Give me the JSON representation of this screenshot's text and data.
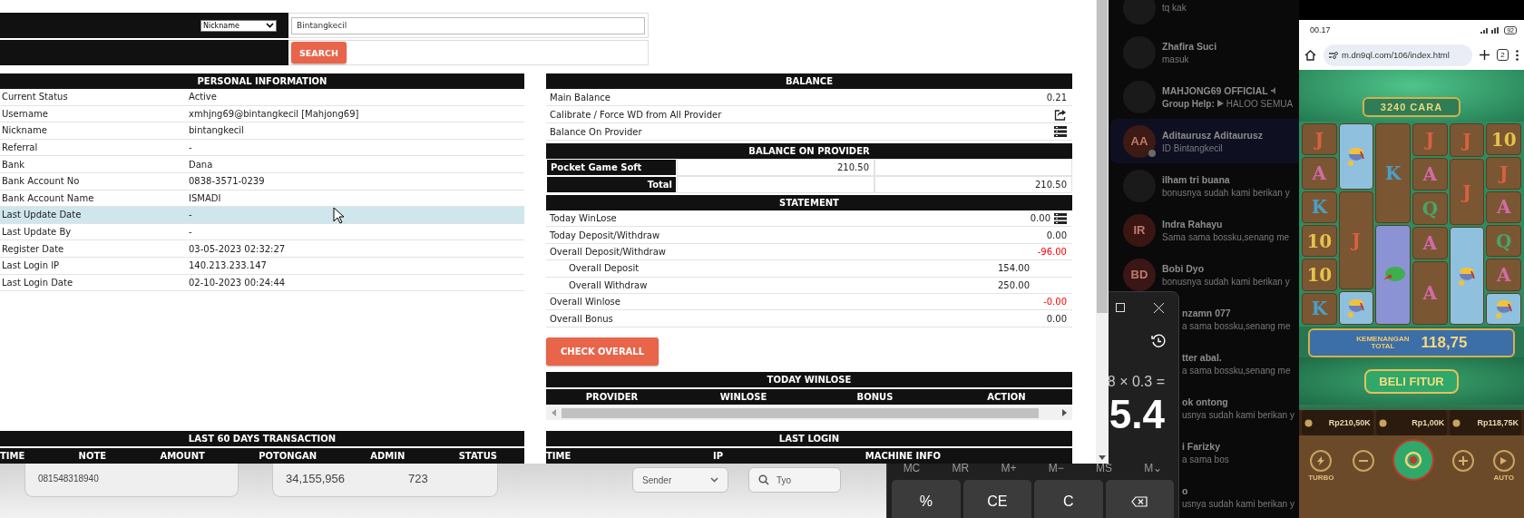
{
  "browser": {
    "search": {
      "field": "Nickname",
      "query": "Bintangkecil",
      "button": "SEARCH"
    },
    "personal_information": {
      "title": "PERSONAL INFORMATION",
      "rows": [
        {
          "label": "Current Status",
          "value": "Active",
          "highlighted": false
        },
        {
          "label": "Username",
          "value": "xmhjng69@bintangkecil  [Mahjong69]",
          "highlighted": false
        },
        {
          "label": "Nickname",
          "value": "bintangkecil",
          "highlighted": false
        },
        {
          "label": "Referral",
          "value": "-",
          "highlighted": false
        },
        {
          "label": "Bank",
          "value": "Dana",
          "highlighted": false
        },
        {
          "label": "Bank Account No",
          "value": "0838-3571-0239",
          "highlighted": false
        },
        {
          "label": "Bank Account Name",
          "value": "ISMADI",
          "highlighted": false
        },
        {
          "label": "Last Update Date",
          "value": "-",
          "highlighted": true
        },
        {
          "label": "Last Update By",
          "value": "-",
          "highlighted": false
        },
        {
          "label": "Register Date",
          "value": "03-05-2023 02:32:27",
          "highlighted": false
        },
        {
          "label": "Last Login IP",
          "value": "140.213.233.147",
          "highlighted": false
        },
        {
          "label": "Last Login Date",
          "value": "02-10-2023 00:24:44",
          "highlighted": false
        }
      ]
    },
    "last_60_days": {
      "title": "LAST 60 DAYS TRANSACTION",
      "columns": [
        "TIME",
        "NOTE",
        "AMOUNT",
        "POTONGAN",
        "ADMIN",
        "STATUS"
      ]
    },
    "balance": {
      "title": "BALANCE",
      "rows": [
        {
          "kind": "value",
          "label": "Main Balance",
          "value": "0.21"
        },
        {
          "kind": "share",
          "label": "Calibrate / Force WD from All Provider"
        },
        {
          "kind": "list",
          "label": "Balance On Provider"
        }
      ]
    },
    "balance_on_provider": {
      "title": "BALANCE ON PROVIDER",
      "rows": [
        {
          "name": "Pocket Game Soft",
          "amount": "210.50"
        }
      ],
      "total": {
        "label": "Total",
        "amount": "210.50"
      }
    },
    "statement": {
      "title": "STATEMENT",
      "rows": [
        {
          "kind": "with-list",
          "label": "Today WinLose",
          "value": "0.00",
          "color": "#222222"
        },
        {
          "kind": "plain",
          "label": "Today Deposit/Withdraw",
          "value": "0.00",
          "color": "#222222"
        },
        {
          "kind": "plain",
          "label": "Overall Deposit/Withdraw",
          "value": "-96.00",
          "color": "#ff0000"
        },
        {
          "kind": "sub",
          "label": "Overall Deposit",
          "value": "154.00",
          "color": "#222222"
        },
        {
          "kind": "sub",
          "label": "Overall Withdraw",
          "value": "250.00",
          "color": "#222222"
        },
        {
          "kind": "plain",
          "label": "Overall Winlose",
          "value": "-0.00",
          "color": "#ff0000"
        },
        {
          "kind": "plain",
          "label": "Overall Bonus",
          "value": "0.00",
          "color": "#222222"
        }
      ]
    },
    "check_button": "CHECK OVERALL",
    "today_winlose": {
      "title": "TODAY WINLOSE",
      "columns": [
        "PROVIDER",
        "WINLOSE",
        "BONUS",
        "ACTION"
      ]
    },
    "last_login": {
      "title": "LAST LOGIN",
      "columns": [
        "TIME",
        "IP",
        "MACHINE INFO"
      ]
    }
  },
  "background_app": {
    "phone_field": "081548318940",
    "amount": "34,155,956",
    "count": "723",
    "sender_select": "Sender",
    "search_value": "Tyo"
  },
  "chat_list": {
    "chats": [
      {
        "kind": "photo",
        "message": "tq kak",
        "selected": false
      },
      {
        "kind": "photo",
        "name": "Zhafira Suci",
        "message": "masuk",
        "selected": false
      },
      {
        "kind": "photo",
        "name": "MAHJONG69 OFFICIAL",
        "muted": true,
        "sender": "Group Help:",
        "message": "HALOO SEMUA",
        "selected": false
      },
      {
        "kind": "initials",
        "initials": "AA",
        "color": "#3d1a14",
        "online": true,
        "name": "Aditaurusz Aditaurusz",
        "message": "ID Bintangkecil",
        "selected": true
      },
      {
        "kind": "photo",
        "name": "ilham tri buana",
        "message": "bonusnya sudah kami berikan y",
        "selected": false
      },
      {
        "kind": "initials",
        "initials": "IR",
        "color": "#3a1612",
        "name": "Indra Rahayu",
        "message": "Sama sama bossku,senang me",
        "selected": false
      },
      {
        "kind": "initials",
        "initials": "BD",
        "color": "#3a1616",
        "name": "Bobi Dyo",
        "message": "bonusnya sudah kami berikan y",
        "selected": false
      }
    ],
    "chats_behind_calculator": [
      {
        "name": "nzamn 077",
        "message": "a sama bossku,senang me"
      },
      {
        "name": "tter abal.",
        "message": "a sama bossku,senang me"
      },
      {
        "name": "ok ontong",
        "message": "usnya sudah kami berikan y"
      },
      {
        "name": "i Farizky",
        "message": "a sama bos"
      },
      {
        "name": "o",
        "message": "usnya sudah kami berikan y"
      }
    ]
  },
  "calculator": {
    "expression": "8 × 0.3 =",
    "display": "5.4",
    "memory": [
      "MC",
      "MR",
      "M+",
      "M−",
      "MS",
      "M⌄"
    ],
    "keys": [
      {
        "kind": "text",
        "label": "%"
      },
      {
        "kind": "text",
        "label": "CE"
      },
      {
        "kind": "text",
        "label": "C"
      },
      {
        "kind": "backspace"
      }
    ]
  },
  "phone": {
    "time": "00.17",
    "battery": "92",
    "url": "m.dn9ql.com/106/index.html",
    "tabs": "2",
    "game": {
      "ways": "3240 CARA",
      "reels": [
        [
          {
            "kind": "letter",
            "symbol": "J",
            "color": "#d9613f"
          },
          {
            "kind": "letter",
            "symbol": "A",
            "color": "#d26aa8"
          },
          {
            "kind": "letter",
            "symbol": "K",
            "color": "#4aa0c8"
          },
          {
            "kind": "letter",
            "symbol": "10",
            "color": "#e6c24a"
          },
          {
            "kind": "letter",
            "symbol": "10",
            "color": "#e6c24a"
          },
          {
            "kind": "letter",
            "symbol": "K",
            "color": "#4aa0c8"
          }
        ],
        [
          {
            "kind": "pot-double"
          },
          {
            "kind": "letter-triple",
            "symbol": "J",
            "color": "#d9613f"
          },
          {
            "kind": "pot"
          }
        ],
        [
          {
            "kind": "letter-triple",
            "symbol": "K",
            "color": "#4aa0c8"
          },
          {
            "kind": "bundle-triple"
          }
        ],
        [
          {
            "kind": "letter",
            "symbol": "J",
            "color": "#d9613f"
          },
          {
            "kind": "letter",
            "symbol": "A",
            "color": "#d26aa8"
          },
          {
            "kind": "letter",
            "symbol": "Q",
            "color": "#47a56a"
          },
          {
            "kind": "letter",
            "symbol": "A",
            "color": "#d26aa8"
          },
          {
            "kind": "letter-double",
            "symbol": "A",
            "color": "#d26aa8"
          }
        ],
        [
          {
            "kind": "letter",
            "symbol": "J",
            "color": "#d9613f"
          },
          {
            "kind": "letter-double",
            "symbol": "J",
            "color": "#d9613f"
          },
          {
            "kind": "pot-triple"
          }
        ],
        [
          {
            "kind": "letter",
            "symbol": "10",
            "color": "#e6c24a"
          },
          {
            "kind": "letter",
            "symbol": "J",
            "color": "#d9613f"
          },
          {
            "kind": "letter",
            "symbol": "A",
            "color": "#d26aa8"
          },
          {
            "kind": "letter",
            "symbol": "Q",
            "color": "#47a56a"
          },
          {
            "kind": "letter",
            "symbol": "A",
            "color": "#d26aa8"
          },
          {
            "kind": "pot"
          }
        ]
      ],
      "win_label": "KEMENANGAN TOTAL",
      "win_amount": "118,75",
      "buy_button": "BELI FITUR",
      "balances": [
        "Rp210,50K",
        "Rp1,00K",
        "Rp118,75K"
      ],
      "controls": [
        {
          "kind": "turbo",
          "label": "TURBO"
        },
        {
          "kind": "minus"
        },
        {
          "kind": "spin"
        },
        {
          "kind": "plus"
        },
        {
          "kind": "auto",
          "label": "AUTO"
        }
      ]
    }
  }
}
